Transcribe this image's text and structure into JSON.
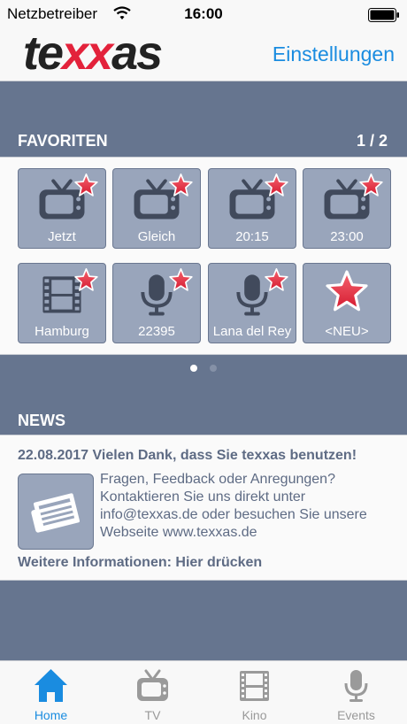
{
  "status_bar": {
    "carrier": "Netzbetreiber",
    "time": "16:00"
  },
  "header": {
    "logo_text": "texxas",
    "settings_label": "Einstellungen"
  },
  "favorites": {
    "title": "FAVORITEN",
    "pager": "1 / 2",
    "tiles": [
      {
        "label": "Jetzt",
        "icon": "tv-icon"
      },
      {
        "label": "Gleich",
        "icon": "tv-icon"
      },
      {
        "label": "20:15",
        "icon": "tv-icon"
      },
      {
        "label": "23:00",
        "icon": "tv-icon"
      },
      {
        "label": "Hamburg",
        "icon": "film-icon"
      },
      {
        "label": "22395",
        "icon": "microphone-icon"
      },
      {
        "label": "Lana del Rey",
        "icon": "microphone-icon"
      },
      {
        "label": "<NEU>",
        "icon": "star-icon"
      }
    ]
  },
  "news": {
    "title": "NEWS",
    "date": "22.08.2017",
    "headline": "Vielen Dank, dass Sie texxas benutzen!",
    "lines": [
      "Fragen, Feedback oder Anregungen?",
      "Kontaktieren Sie uns direkt unter",
      "info@texxas.de oder besuchen Sie unsere",
      "Webseite www.texxas.de"
    ],
    "more": "Weitere Informationen: Hier drücken"
  },
  "tabbar": {
    "tabs": [
      {
        "label": "Home",
        "icon": "home-icon",
        "active": true
      },
      {
        "label": "TV",
        "icon": "tv-icon",
        "active": false
      },
      {
        "label": "Kino",
        "icon": "film-icon",
        "active": false
      },
      {
        "label": "Events",
        "icon": "microphone-icon",
        "active": false
      }
    ]
  },
  "colors": {
    "accent": "#1a8ce0",
    "header_bg": "#66758f",
    "tile_bg": "#99a5bb",
    "star": "#e3223b",
    "text_gray": "#5e6b84"
  }
}
